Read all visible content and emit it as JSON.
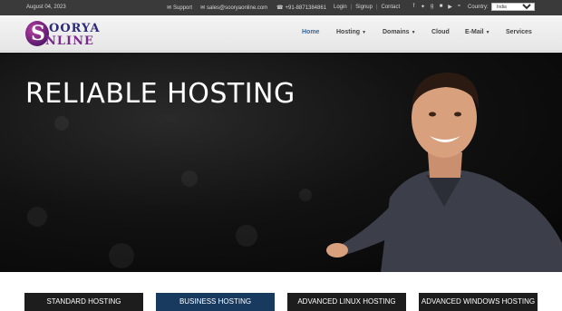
{
  "topbar": {
    "date": "August 04, 2023",
    "support": "Support",
    "email": "sales@sooryaonline.com",
    "phone": "+91-8871384861",
    "login": "Login",
    "separator": "|",
    "signup": "Signup",
    "contact": "Contact",
    "country_label": "Country:",
    "country_value": "India",
    "social_icons": [
      "facebook-icon",
      "twitter-icon",
      "google-plus-icon",
      "linkedin-icon",
      "youtube-icon",
      "rss-icon"
    ]
  },
  "logo": {
    "letter": "S",
    "word1": "OORYA",
    "word2": "NLINE"
  },
  "nav": {
    "home": "Home",
    "hosting": "Hosting",
    "domains": "Domains",
    "cloud": "Cloud",
    "email": "E-Mail",
    "services": "Services"
  },
  "hero": {
    "title": "RELIABLE HOSTING"
  },
  "tabs": [
    {
      "label": "STANDARD HOSTING"
    },
    {
      "label": "BUSINESS HOSTING"
    },
    {
      "label": "ADVANCED LINUX HOSTING"
    },
    {
      "label": "ADVANCED WINDOWS HOSTING"
    }
  ],
  "colors": {
    "topbar_bg": "#3a3a3a",
    "nav_active": "#2a6aa8",
    "tab_bg": "#1d1d1d",
    "tab_active_bg": "#173a5e"
  }
}
